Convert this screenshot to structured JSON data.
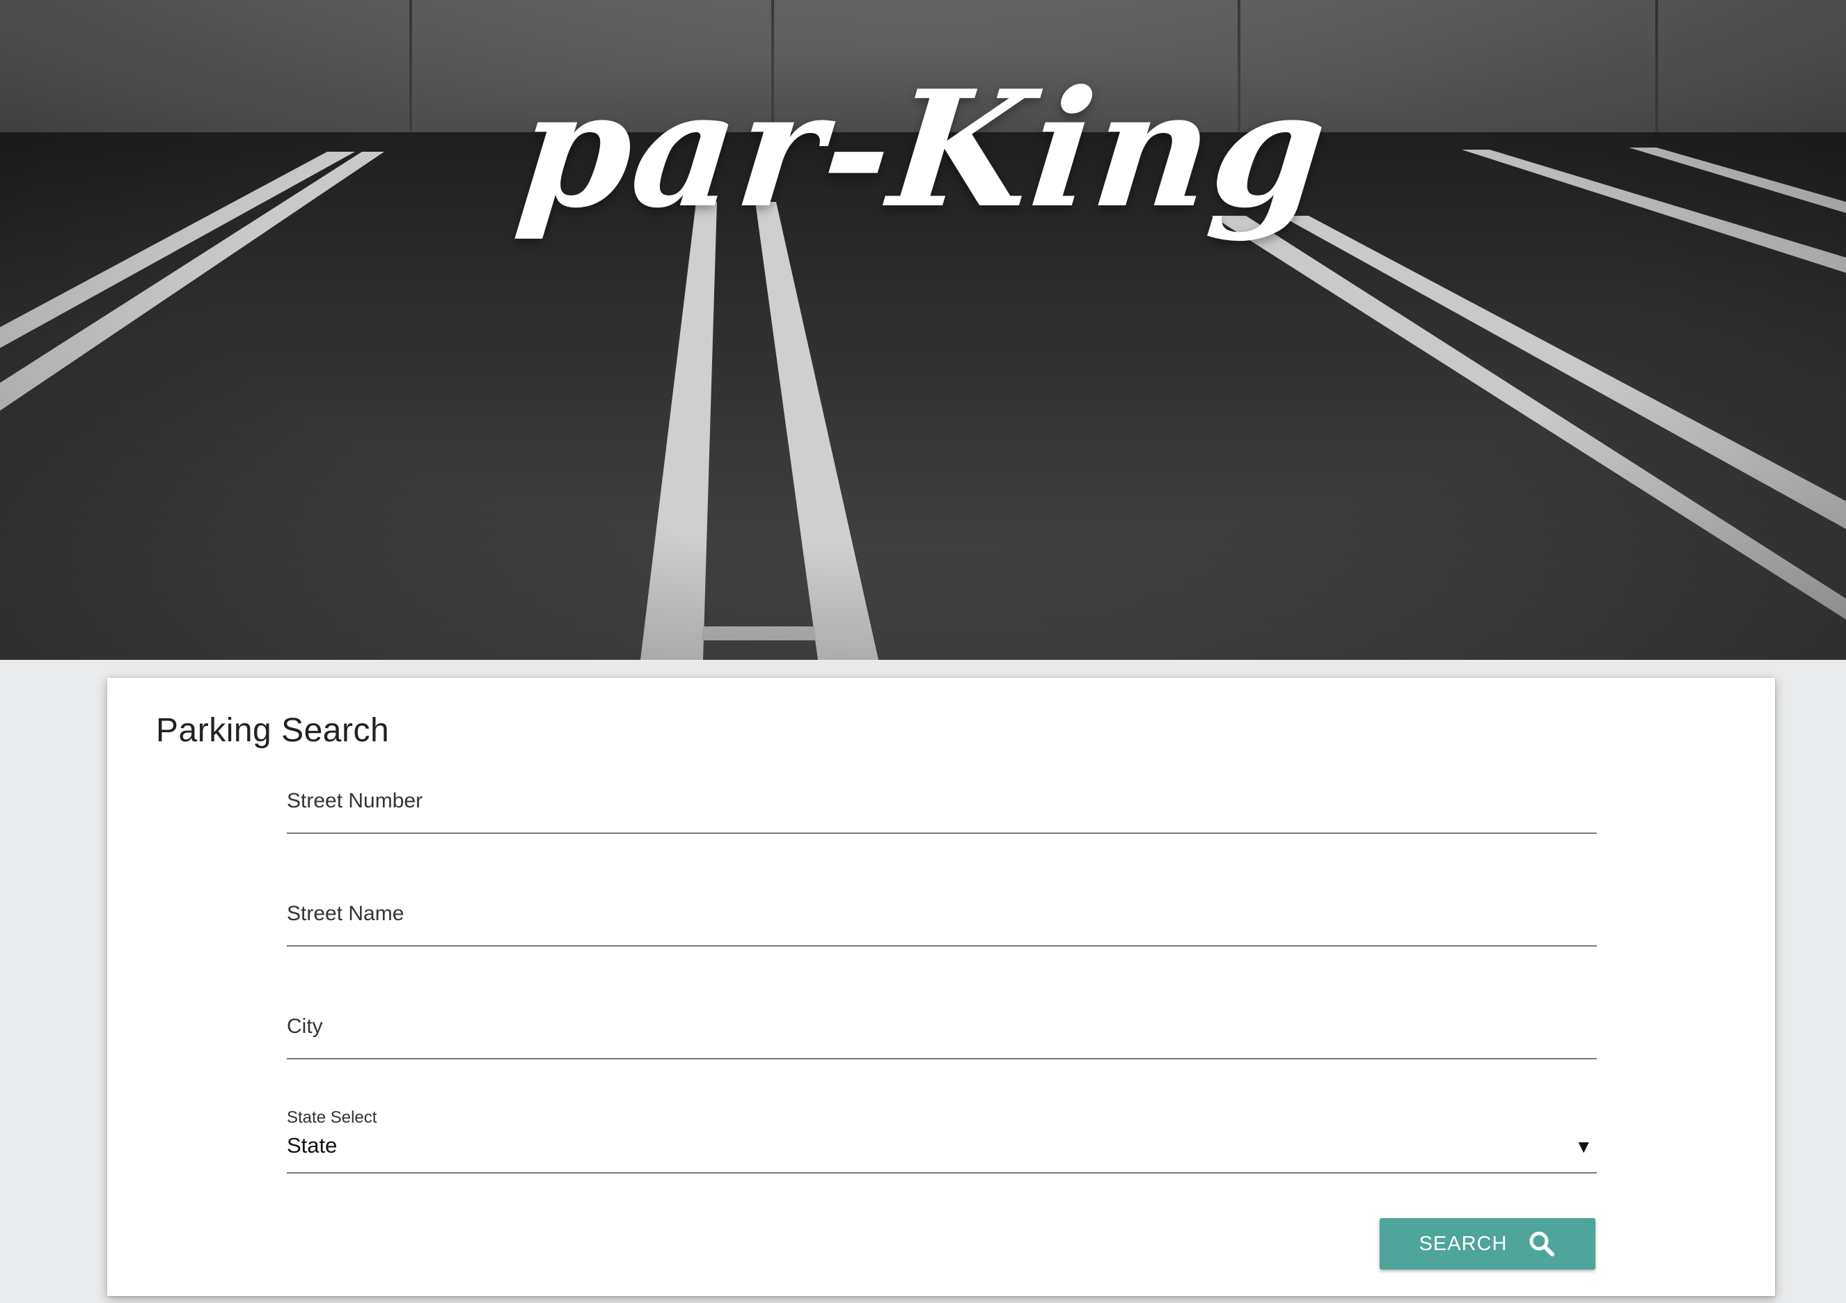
{
  "hero": {
    "logo_text": "par-King"
  },
  "card": {
    "title": "Parking Search",
    "fields": {
      "street_number": {
        "label": "Street Number",
        "value": ""
      },
      "street_name": {
        "label": "Street Name",
        "value": ""
      },
      "city": {
        "label": "City",
        "value": ""
      },
      "state": {
        "label": "State Select",
        "selected": "State"
      }
    },
    "search_button": {
      "label": "SEARCH",
      "icon": "search-icon",
      "color": "#4fa59a"
    }
  }
}
